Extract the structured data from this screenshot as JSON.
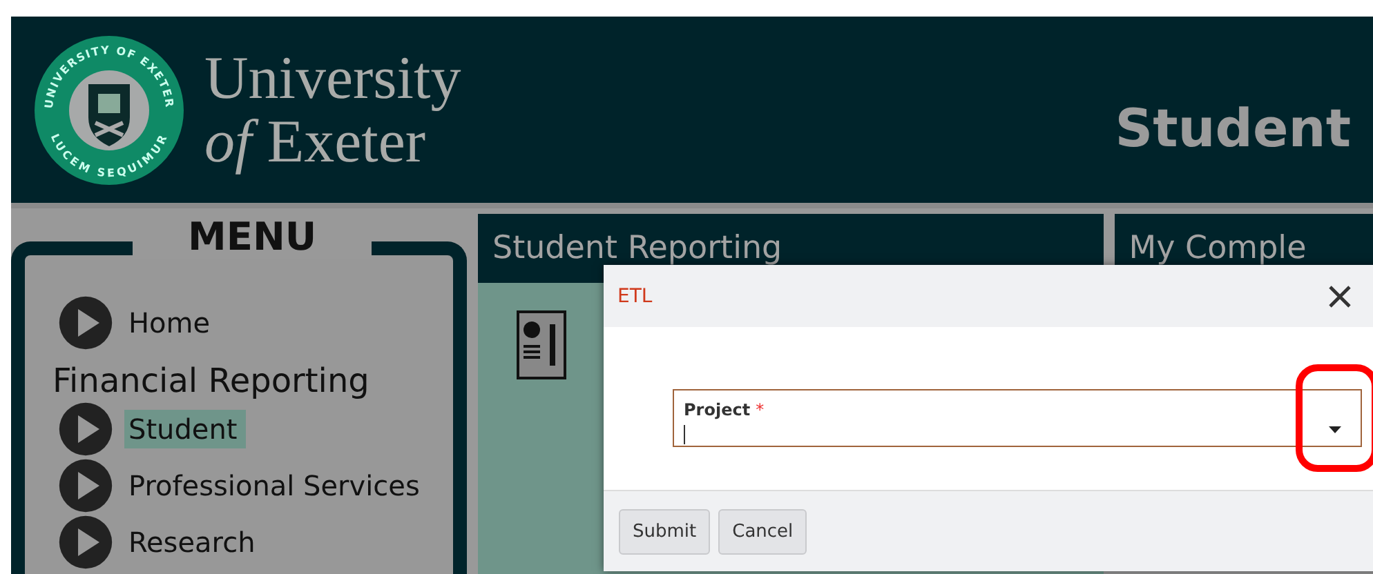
{
  "header": {
    "logo_ring_top": "UNIVERSITY OF EXETER",
    "logo_ring_bottom": "LUCEM SEQUIMUR",
    "brand_line_1": "University",
    "brand_line_2": "*of* Exeter",
    "title": "Student"
  },
  "menu": {
    "title": "MENU",
    "items": [
      {
        "kind": "link",
        "label": "Home",
        "selected": false
      },
      {
        "kind": "heading",
        "label": "Financial Reporting"
      },
      {
        "kind": "link",
        "label": "Student",
        "selected": true
      },
      {
        "kind": "link",
        "label": "Professional Services",
        "selected": false
      },
      {
        "kind": "link",
        "label": "Research",
        "selected": false
      }
    ]
  },
  "panels": [
    {
      "title": "Student Reporting"
    },
    {
      "title": "My Comple"
    }
  ],
  "dialog": {
    "title": "ETL",
    "field": {
      "label": "Project",
      "required_mark": "*"
    },
    "buttons": [
      "Submit",
      "Cancel"
    ]
  }
}
